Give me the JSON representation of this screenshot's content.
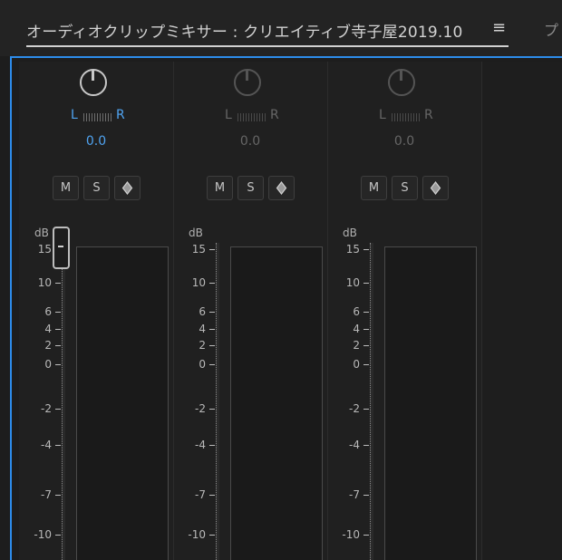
{
  "header": {
    "title": "オーディオクリップミキサー : クリエイティブ寺子屋2019.10",
    "menu_icon": "hamburger-menu-icon",
    "next_tab_label": "プ"
  },
  "colors": {
    "accent": "#2d8ceb",
    "active_text": "#4fa3f0",
    "dim_text": "#666666"
  },
  "channels": [
    {
      "left_label": "L",
      "right_label": "R",
      "pan_value": "0.0",
      "mute_label": "M",
      "solo_label": "S",
      "record_icon": "record-diamond-icon",
      "active": true
    },
    {
      "left_label": "L",
      "right_label": "R",
      "pan_value": "0.0",
      "mute_label": "M",
      "solo_label": "S",
      "record_icon": "record-diamond-icon",
      "active": false
    },
    {
      "left_label": "L",
      "right_label": "R",
      "pan_value": "0.0",
      "mute_label": "M",
      "solo_label": "S",
      "record_icon": "record-diamond-icon",
      "active": false
    }
  ],
  "scale": {
    "unit_label": "dB",
    "ticks": [
      "15",
      "10",
      "6",
      "4",
      "2",
      "0",
      "-2",
      "-4",
      "-7",
      "-10"
    ]
  }
}
